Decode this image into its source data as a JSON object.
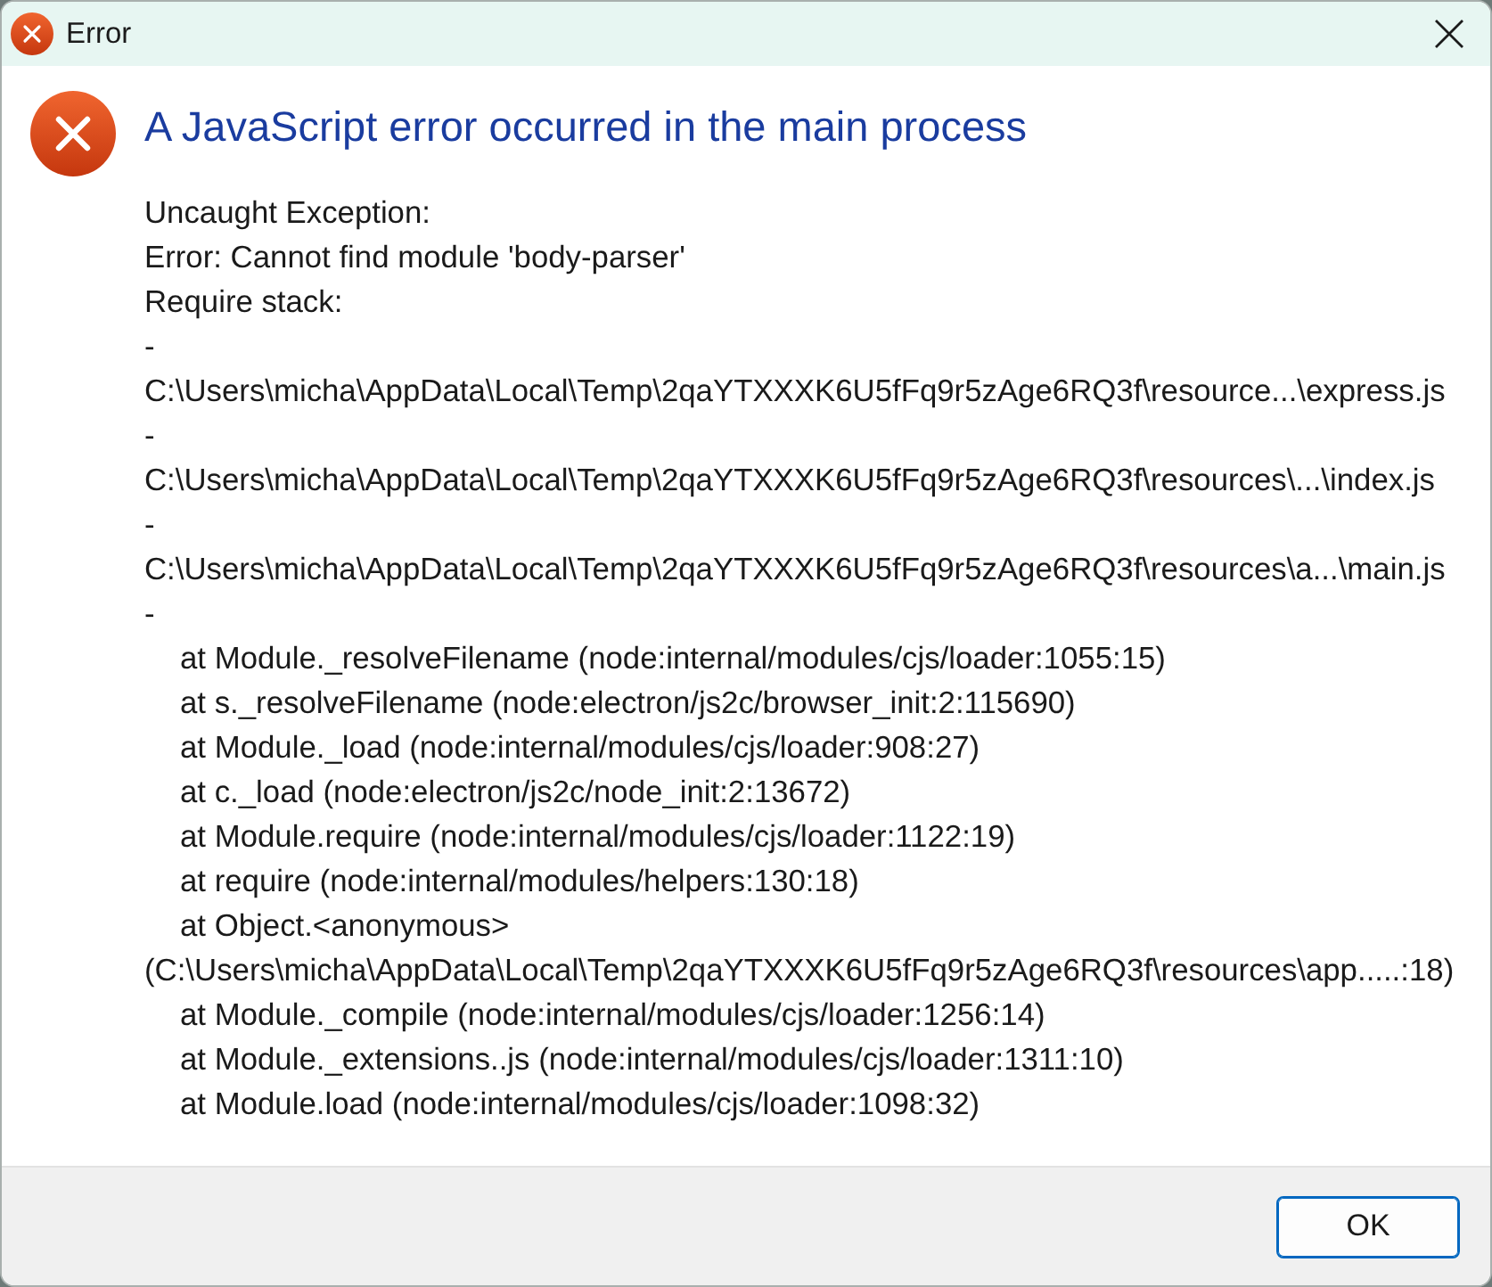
{
  "window": {
    "title": "Error"
  },
  "message": {
    "heading": "A JavaScript error occurred in the main process",
    "lines": [
      {
        "kind": "plain",
        "text": "Uncaught Exception:"
      },
      {
        "kind": "plain",
        "text": "Error: Cannot find module 'body-parser'"
      },
      {
        "kind": "plain",
        "text": "Require stack:"
      },
      {
        "kind": "plain",
        "text": "-"
      },
      {
        "kind": "plain",
        "text": "C:\\Users\\micha\\AppData\\Local\\Temp\\2qaYTXXXK6U5fFq9r5zAge6RQ3f\\resource...\\express.js"
      },
      {
        "kind": "plain",
        "text": "-"
      },
      {
        "kind": "plain",
        "text": "C:\\Users\\micha\\AppData\\Local\\Temp\\2qaYTXXXK6U5fFq9r5zAge6RQ3f\\resources\\...\\index.js"
      },
      {
        "kind": "plain",
        "text": "-"
      },
      {
        "kind": "plain",
        "text": "C:\\Users\\micha\\AppData\\Local\\Temp\\2qaYTXXXK6U5fFq9r5zAge6RQ3f\\resources\\a...\\main.js"
      },
      {
        "kind": "plain",
        "text": "-"
      },
      {
        "kind": "frame",
        "text": "at Module._resolveFilename (node:internal/modules/cjs/loader:1055:15)"
      },
      {
        "kind": "frame",
        "text": "at s._resolveFilename (node:electron/js2c/browser_init:2:115690)"
      },
      {
        "kind": "frame",
        "text": "at Module._load (node:internal/modules/cjs/loader:908:27)"
      },
      {
        "kind": "frame",
        "text": "at c._load (node:electron/js2c/node_init:2:13672)"
      },
      {
        "kind": "frame",
        "text": "at Module.require (node:internal/modules/cjs/loader:1122:19)"
      },
      {
        "kind": "frame",
        "text": "at require (node:internal/modules/helpers:130:18)"
      },
      {
        "kind": "frame",
        "text": "at Object.<anonymous>"
      },
      {
        "kind": "plain",
        "text": "(C:\\Users\\micha\\AppData\\Local\\Temp\\2qaYTXXXK6U5fFq9r5zAge6RQ3f\\resources\\app.....:18)"
      },
      {
        "kind": "frame",
        "text": "at Module._compile (node:internal/modules/cjs/loader:1256:14)"
      },
      {
        "kind": "frame",
        "text": "at Module._extensions..js (node:internal/modules/cjs/loader:1311:10)"
      },
      {
        "kind": "frame",
        "text": "at Module.load (node:internal/modules/cjs/loader:1098:32)"
      }
    ]
  },
  "buttons": [
    {
      "label": "OK",
      "focused": true
    }
  ]
}
